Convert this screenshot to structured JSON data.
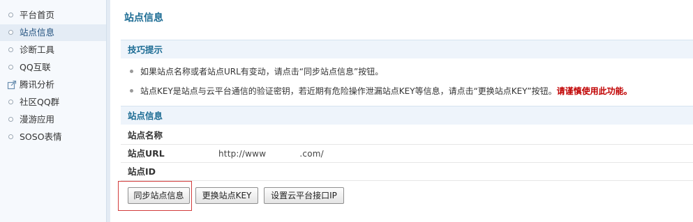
{
  "sidebar": {
    "items": [
      {
        "label": "平台首页",
        "icon": "circle-bullet-icon",
        "active": false
      },
      {
        "label": "站点信息",
        "icon": "circle-bullet-icon",
        "active": true
      },
      {
        "label": "诊断工具",
        "icon": "circle-bullet-icon",
        "active": false
      },
      {
        "label": "QQ互联",
        "icon": "circle-bullet-icon",
        "active": false
      },
      {
        "label": "腾讯分析",
        "icon": "external-link-icon",
        "active": false
      },
      {
        "label": "社区QQ群",
        "icon": "circle-bullet-icon",
        "active": false
      },
      {
        "label": "漫游应用",
        "icon": "circle-bullet-icon",
        "active": false
      },
      {
        "label": "SOSO表情",
        "icon": "circle-bullet-icon",
        "active": false
      }
    ]
  },
  "page": {
    "title": "站点信息"
  },
  "tips": {
    "header": "技巧提示",
    "items": [
      {
        "text": "如果站点名称或者站点URL有变动，请点击“同步站点信息”按钮。",
        "warn": ""
      },
      {
        "text": "站点KEY是站点与云平台通信的验证密钥，若近期有危险操作泄漏站点KEY等信息，请点击“更换站点KEY”按钮。",
        "warn": "请谨慎使用此功能。"
      }
    ]
  },
  "site_info": {
    "header": "站点信息",
    "rows": [
      {
        "label": "站点名称",
        "value": ""
      },
      {
        "label": "站点URL",
        "value": "http://www            .com/"
      },
      {
        "label": "站点ID",
        "value": ""
      }
    ]
  },
  "buttons": {
    "sync": "同步站点信息",
    "change_key": "更换站点KEY",
    "set_ip": "设置云平台接口IP"
  },
  "colors": {
    "accent": "#1b6b93",
    "warning": "#c00000",
    "highlight": "#d23c3c"
  }
}
